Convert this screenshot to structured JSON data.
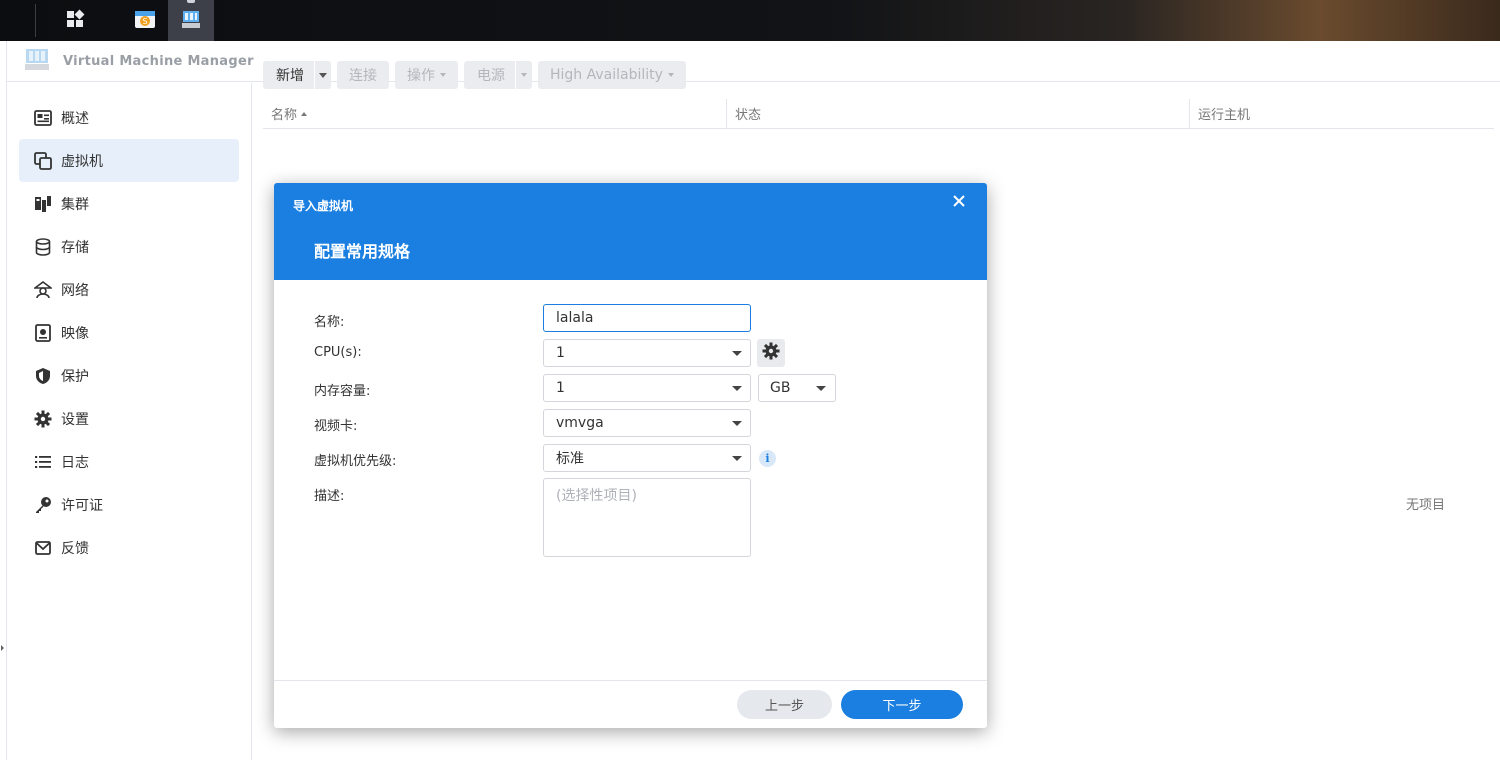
{
  "app": {
    "title": "Virtual Machine Manager"
  },
  "sidebar": {
    "items": [
      {
        "label": "概述",
        "icon": "overview-icon"
      },
      {
        "label": "虚拟机",
        "icon": "vm-icon",
        "active": true
      },
      {
        "label": "集群",
        "icon": "cluster-icon"
      },
      {
        "label": "存储",
        "icon": "storage-icon"
      },
      {
        "label": "网络",
        "icon": "network-icon"
      },
      {
        "label": "映像",
        "icon": "image-icon"
      },
      {
        "label": "保护",
        "icon": "shield-icon"
      },
      {
        "label": "设置",
        "icon": "gear-icon"
      },
      {
        "label": "日志",
        "icon": "log-icon"
      },
      {
        "label": "许可证",
        "icon": "key-icon"
      },
      {
        "label": "反馈",
        "icon": "mail-icon"
      }
    ]
  },
  "toolbar": {
    "add": "新增",
    "connect": "连接",
    "action": "操作",
    "power": "电源",
    "ha": "High Availability"
  },
  "table": {
    "columns": [
      "名称",
      "状态",
      "运行主机"
    ],
    "empty": "无项目"
  },
  "dialog": {
    "title": "导入虚拟机",
    "step": "配置常用规格",
    "fields": {
      "name_label": "名称:",
      "name_value": "lalala",
      "cpu_label": "CPU(s):",
      "cpu_value": "1",
      "mem_label": "内存容量:",
      "mem_value": "1",
      "mem_unit": "GB",
      "video_label": "视频卡:",
      "video_value": "vmvga",
      "priority_label": "虚拟机优先级:",
      "priority_value": "标准",
      "desc_label": "描述:",
      "desc_placeholder": "(选择性项目)"
    },
    "prev": "上一步",
    "next": "下一步"
  },
  "colors": {
    "accent": "#1a7fe0",
    "active_nav": "#e6effa"
  }
}
